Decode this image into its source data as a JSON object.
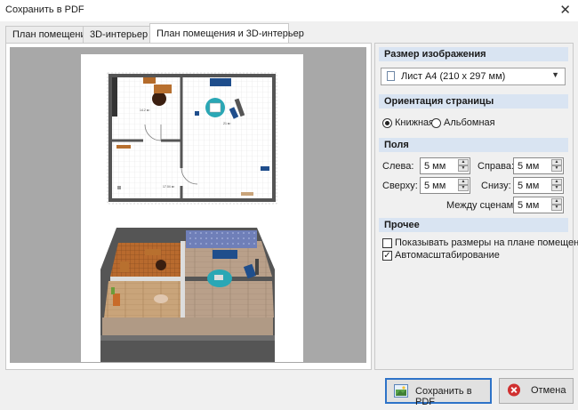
{
  "window": {
    "title": "Сохранить в PDF",
    "close_glyph": "✕"
  },
  "tabs": [
    {
      "label": "План помещения"
    },
    {
      "label": "3D-интерьер"
    },
    {
      "label": "План помещения и 3D-интерьер"
    }
  ],
  "floor_plan": {
    "area_labels": [
      "14.2 м²",
      "21 м²",
      "17.04 м²"
    ]
  },
  "settings": {
    "image_size": {
      "header": "Размер изображения",
      "value": "Лист A4 (210 x 297 мм)"
    },
    "orientation": {
      "header": "Ориентация страницы",
      "portrait": "Книжная",
      "landscape": "Альбомная",
      "selected": "portrait"
    },
    "margins": {
      "header": "Поля",
      "left_label": "Слева:",
      "left_value": "5 мм",
      "right_label": "Справа:",
      "right_value": "5 мм",
      "top_label": "Сверху:",
      "top_value": "5 мм",
      "bottom_label": "Снизу:",
      "bottom_value": "5 мм",
      "between_label": "Между сценами:",
      "between_value": "5 мм"
    },
    "other": {
      "header": "Прочее",
      "show_sizes": {
        "label": "Показывать размеры на плане помещения",
        "checked": false
      },
      "autoscale": {
        "label": "Автомасштабирование",
        "checked": true
      }
    }
  },
  "buttons": {
    "save": "Сохранить в PDF",
    "cancel": "Отмена"
  },
  "colors": {
    "accent_blue": "#2e73c8",
    "header_bg": "#d9e4f2",
    "rug_teal": "#2aa7b5",
    "sofa_blue": "#1f4e8c",
    "cancel_red": "#d03030"
  }
}
